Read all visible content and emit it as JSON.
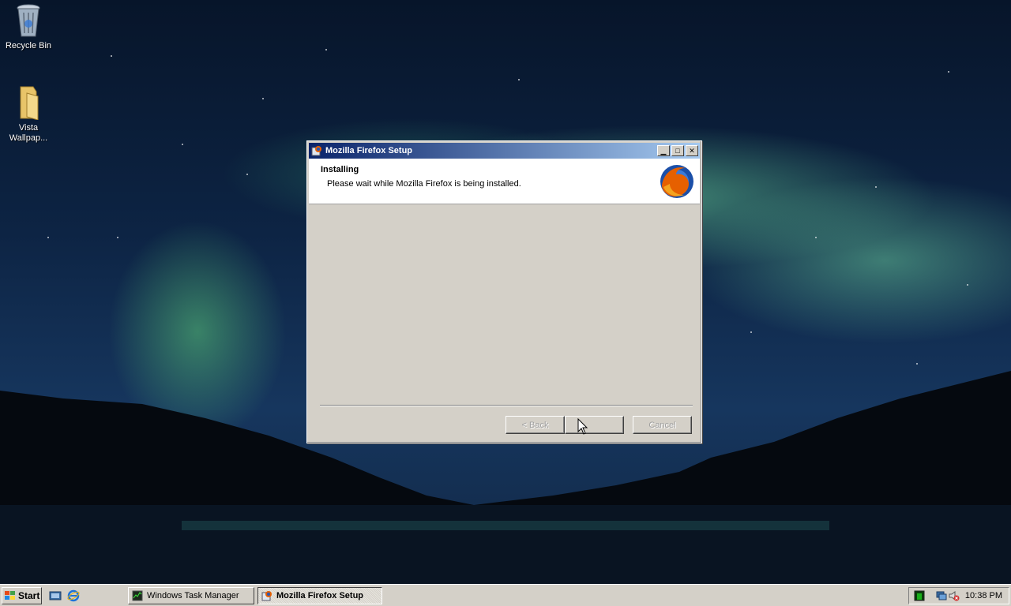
{
  "desktop": {
    "icons": [
      {
        "label": "Recycle Bin",
        "icon": "recycle-bin-icon"
      },
      {
        "label": "Vista Wallpap...",
        "icon": "folder-icon"
      }
    ]
  },
  "window": {
    "title": "Mozilla Firefox Setup",
    "controls": [
      "minimize",
      "maximize",
      "close"
    ],
    "header": {
      "title": "Installing",
      "subtitle": "Please wait while Mozilla Firefox is being installed.",
      "logo": "firefox-logo-icon"
    },
    "buttons": {
      "back": "< Back",
      "next": "",
      "cancel": "Cancel"
    }
  },
  "taskbar": {
    "start_label": "Start",
    "quick_launch": [
      "show-desktop-icon",
      "internet-explorer-icon"
    ],
    "tasks": [
      {
        "label": "Windows Task Manager",
        "icon": "task-manager-icon",
        "active": false
      },
      {
        "label": "Mozilla Firefox Setup",
        "icon": "setup-icon",
        "active": true
      }
    ],
    "tray_icons": [
      "cpu-meter-icon",
      "network-icon",
      "volume-muted-icon"
    ],
    "clock": "10:38 PM"
  }
}
